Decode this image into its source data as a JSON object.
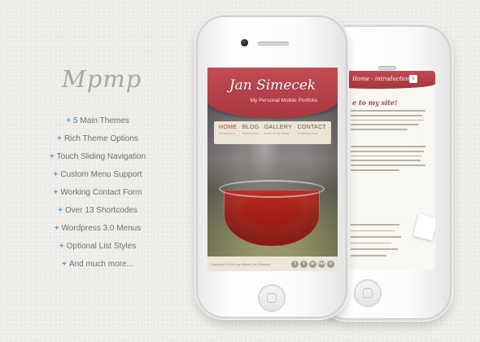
{
  "logo": "Mpmp",
  "features": [
    "5 Main Themes",
    "Rich Theme Options",
    "Touch Sliding Navigation",
    "Custom Menu Support",
    "Working Contact Form",
    "Over 13 Shortcodes",
    "Wordpress 3.0 Menus",
    "Optional List Styles",
    "And much more..."
  ],
  "feature_prefix": "+",
  "front_phone": {
    "site_name": "Jan Simecek",
    "tagline": "My Personal Mobile Portfolio",
    "menu": [
      {
        "label": "HOME",
        "sub": "Introduction",
        "active": true
      },
      {
        "label": "BLOG",
        "sub": "Select news"
      },
      {
        "label": "GALLERY",
        "sub": "some of my works"
      },
      {
        "label": "CONTACT",
        "sub": "Feedback form"
      }
    ],
    "copyright": "Copyright © 2011 by eMonk Jan Simecek",
    "socials": [
      "f",
      "t",
      "in",
      "rss",
      "v"
    ]
  },
  "back_phone": {
    "header_title": "Home - introduction",
    "header_icon": "≡",
    "heading": "e to my site!",
    "heading2": "rk"
  },
  "colors": {
    "accent": "#b23e46",
    "plus": "#47a8d8",
    "text": "#6f6f6f",
    "logo": "#a8a7a4"
  }
}
